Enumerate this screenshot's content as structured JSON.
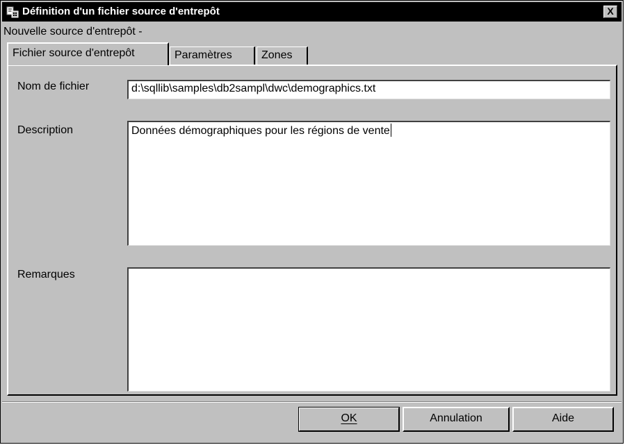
{
  "window": {
    "title": "Définition d'un fichier source d'entrepôt",
    "close_label": "X",
    "subtitle": "Nouvelle source d'entrepôt -"
  },
  "tabs": [
    {
      "label": "Fichier source d'entrepôt",
      "active": true
    },
    {
      "label": "Paramètres",
      "active": false
    },
    {
      "label": "Zones",
      "active": false
    }
  ],
  "form": {
    "file_name_label": "Nom de fichier",
    "file_name_value": "d:\\sqllib\\samples\\db2sampl\\dwc\\demographics.txt",
    "description_label": "Description",
    "description_value": "Données démographiques pour les régions de vente",
    "remarks_label": "Remarques",
    "remarks_value": ""
  },
  "buttons": {
    "ok": "OK",
    "cancel": "Annulation",
    "help": "Aide"
  },
  "colors": {
    "titlebar": "#000000",
    "window_bg": "#c0c0c0",
    "field_bg": "#ffffff"
  }
}
